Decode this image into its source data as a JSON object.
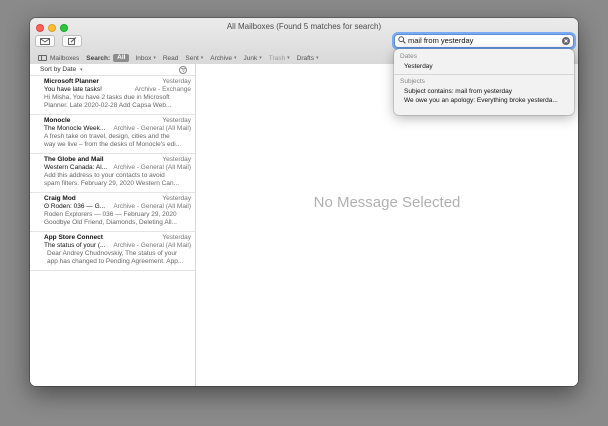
{
  "window": {
    "title": "All Mailboxes (Found 5 matches for search)"
  },
  "toolbar": {
    "get_mail_icon": "envelope-icon",
    "compose_icon": "compose-icon"
  },
  "search": {
    "value": "mail from yesterday",
    "placeholder": "Search"
  },
  "filterbar": {
    "mailboxes_label": "Mailboxes",
    "search_label": "Search:",
    "all_label": "All",
    "items": [
      "Inbox",
      "Read",
      "Sent",
      "Archive",
      "Junk",
      "Trash",
      "Drafts"
    ]
  },
  "list": {
    "sort_label": "Sort by Date",
    "messages": [
      {
        "sender": "Microsoft Planner",
        "date": "Yesterday",
        "subject": "You have late tasks!",
        "mailbox": "Archive - Exchange",
        "preview1": "Hi Misha, You have 2 tasks due in Microsoft",
        "preview2": "Planner. Late 2020-02-28 Add Capsa Web..."
      },
      {
        "sender": "Monocle",
        "date": "Yesterday",
        "subject": "The Monocle Week...",
        "mailbox": "Archive - General (All Mail)",
        "preview1": "A fresh take on travel, design, cities and the",
        "preview2": "way we live – from the desks of Monocle's edi..."
      },
      {
        "sender": "The Globe and Mail",
        "date": "Yesterday",
        "subject": "Western Canada: Al...",
        "mailbox": "Archive - General (All Mail)",
        "preview1": "Add this address to your contacts to avoid",
        "preview2": "spam filters. February 29, 2020 Western Can..."
      },
      {
        "sender": "Craig Mod",
        "date": "Yesterday",
        "subject": "ʘ Roden: 036 — G...",
        "mailbox": "Archive - General (All Mail)",
        "preview1": "Roden Explorers — 036 — February 29, 2020",
        "preview2": "Goodbye Old Friend, Diamonds, Deleting All..."
      },
      {
        "sender": "App Store Connect",
        "date": "Yesterday",
        "subject": "The status of your (...",
        "mailbox": "Archive - General (All Mail)",
        "preview1": "Dear Andrey Chudnovskiy, The status of your",
        "preview2": "app has changed to Pending Agreement. App..."
      }
    ]
  },
  "reading": {
    "empty_text": "No Message Selected"
  },
  "suggestions": {
    "dates_header": "Dates",
    "dates": [
      "Yesterday"
    ],
    "subjects_header": "Subjects",
    "subjects": [
      "Subject contains: mail from yesterday",
      "We owe you an apology: Everything broke yesterda..."
    ]
  },
  "colors": {
    "accent": "#5f8fd9",
    "close": "#fe5f57",
    "minimize": "#febc2e",
    "zoom": "#28c840"
  }
}
